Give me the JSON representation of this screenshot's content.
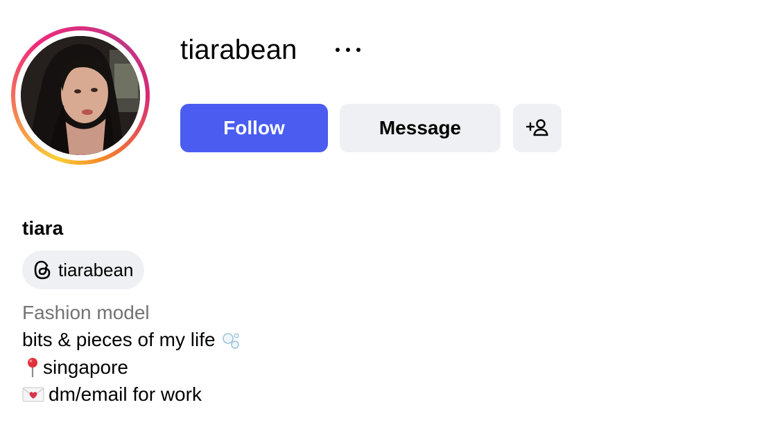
{
  "profile": {
    "username": "tiarabean",
    "display_name": "tiara",
    "threads_handle": "tiarabean",
    "category": "Fashion model",
    "bio_lines": [
      "bits & pieces of my life",
      "singapore",
      "dm/email for work"
    ],
    "bio_emoji": [
      "bubbles-emoji",
      "round-pushpin-emoji",
      "love-letter-emoji"
    ]
  },
  "actions": {
    "follow_label": "Follow",
    "message_label": "Message",
    "suggest_icon": "add-person-icon",
    "more_icon": "more-options-icon"
  },
  "colors": {
    "follow_bg": "#4a5df0",
    "secondary_bg": "#eff0f3",
    "category_text": "#737373"
  }
}
